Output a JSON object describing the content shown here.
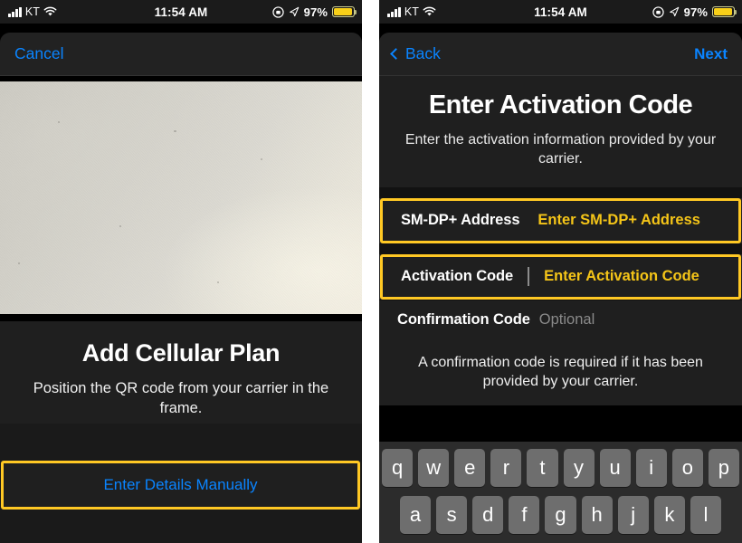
{
  "status_bar": {
    "carrier": "KT",
    "time": "11:54 AM",
    "battery_percent": "97%",
    "signal_icon": "signal-bars-icon",
    "wifi_icon": "wifi-icon",
    "lock_rotation_icon": "rotation-lock-icon",
    "location_icon": "location-arrow-icon",
    "battery_icon": "battery-low-power-icon"
  },
  "colors": {
    "accent_blue": "#0a84ff",
    "highlight_yellow": "#ffc824",
    "field_gold": "#f5c518",
    "sheet_bg": "#1f1f1f",
    "page_bg": "#121212",
    "keyboard_bg": "#2c2c2c",
    "key_bg": "#6e6e6e"
  },
  "left_screen": {
    "nav": {
      "cancel_label": "Cancel"
    },
    "camera": {
      "viewfinder_name": "qr-code-camera-viewfinder"
    },
    "instructions": {
      "title": "Add Cellular Plan",
      "subtitle": "Position the QR code from your carrier in the frame."
    },
    "manual_button": {
      "label": "Enter Details Manually",
      "highlighted": true
    }
  },
  "right_screen": {
    "nav": {
      "back_label": "Back",
      "back_icon": "chevron-left-icon",
      "next_label": "Next"
    },
    "header": {
      "title": "Enter Activation Code",
      "subtitle": "Enter the activation information provided by your carrier."
    },
    "fields": [
      {
        "label": "SM-DP+ Address",
        "placeholder": "Enter SM-DP+ Address",
        "value": "",
        "style": "gold",
        "highlighted": true,
        "focused": false
      },
      {
        "label": "Activation Code",
        "placeholder": "Enter Activation Code",
        "value": "",
        "style": "gold",
        "highlighted": true,
        "focused": true
      },
      {
        "label": "Confirmation Code",
        "placeholder": "Optional",
        "value": "",
        "style": "gray",
        "highlighted": false,
        "focused": false
      }
    ],
    "footer_note": "A confirmation code is required if it has been provided by your carrier.",
    "keyboard": {
      "row1": [
        "q",
        "w",
        "e",
        "r",
        "t",
        "y",
        "u",
        "i",
        "o",
        "p"
      ],
      "row2": [
        "a",
        "s",
        "d",
        "f",
        "g",
        "h",
        "j",
        "k",
        "l"
      ]
    }
  }
}
